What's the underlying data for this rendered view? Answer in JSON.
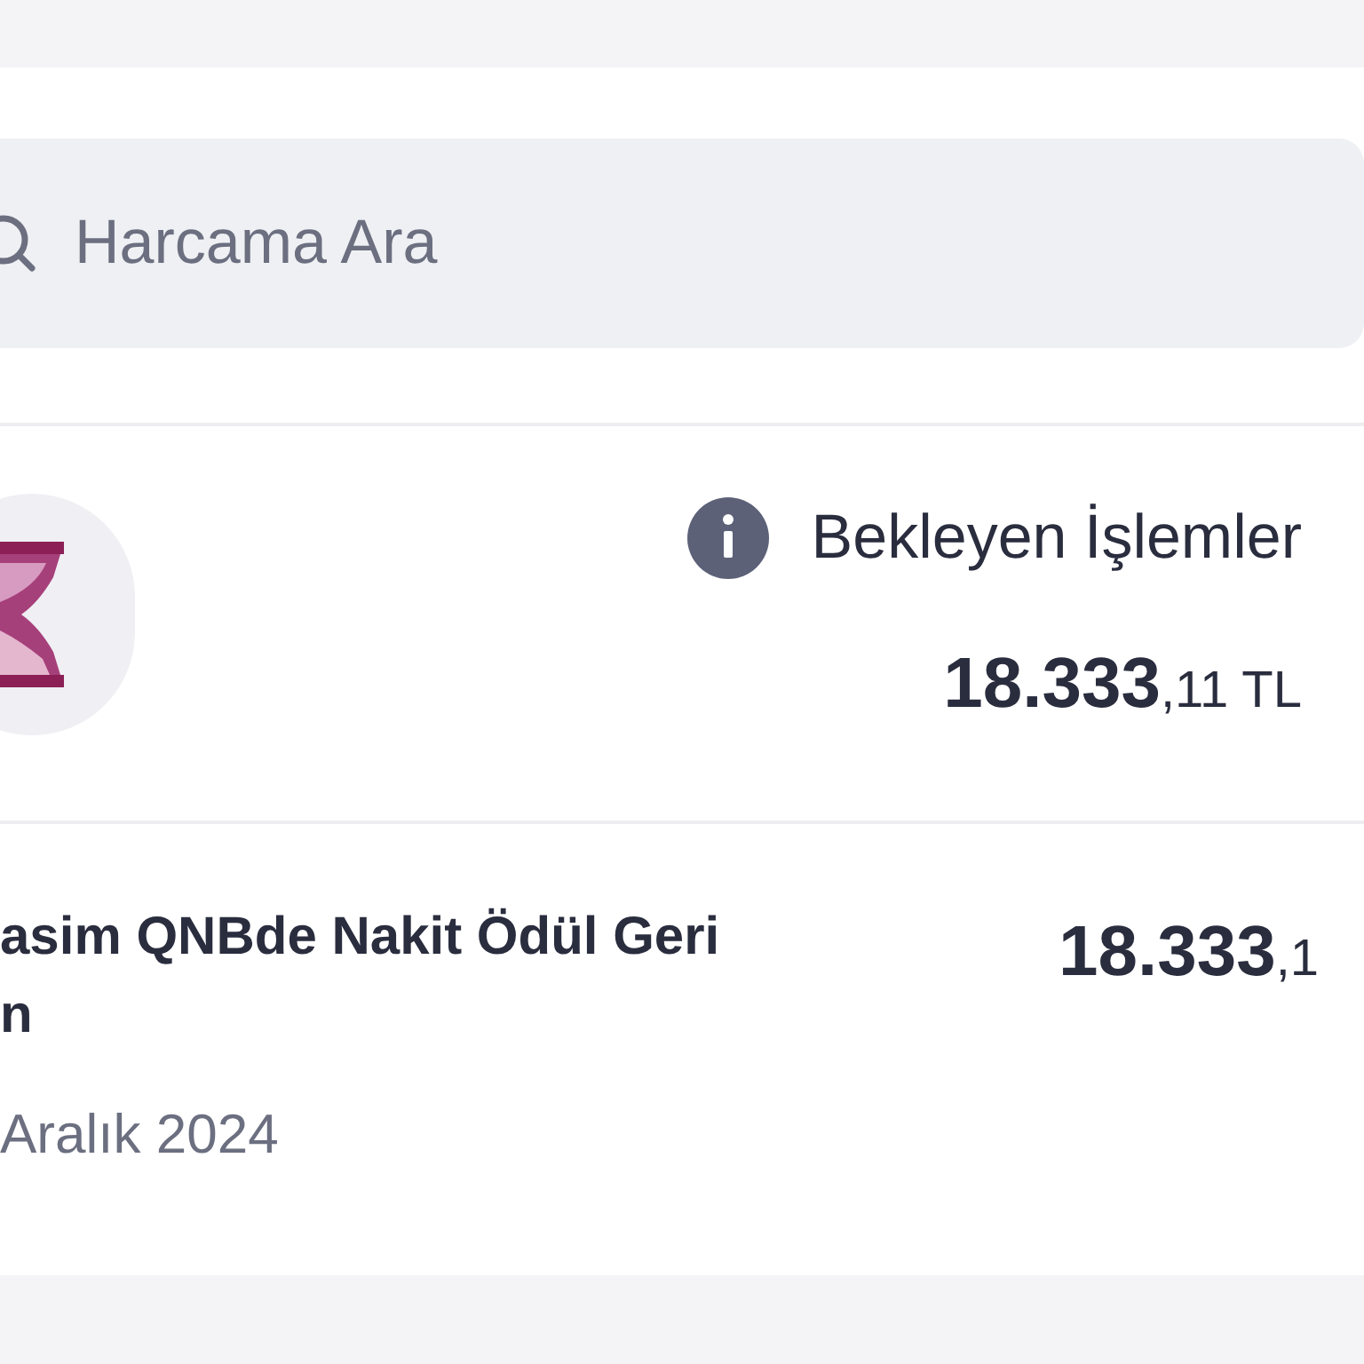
{
  "search": {
    "placeholder": "Harcama Ara"
  },
  "pending": {
    "title": "Bekleyen İşlemler",
    "amount": "**18.333**,11 TL"
  },
  "transactions": [
    {
      "title_line_1": "asim QNBde Nakit Ödül Geri",
      "title_line_2": "n",
      "date": "Aralık 2024",
      "amount": "**18.333**,1"
    }
  ]
}
